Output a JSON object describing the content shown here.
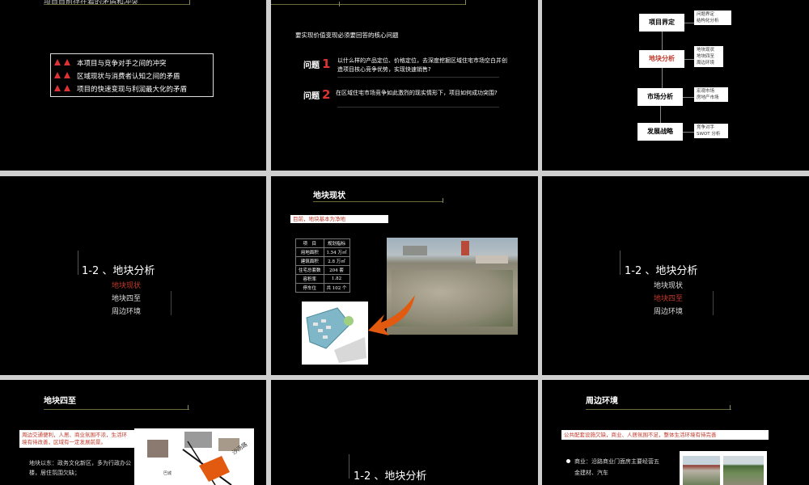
{
  "slide1": {
    "top_text": "项目目前存在着的矛盾和冲突",
    "items": [
      "本项目与竞争对手之间的冲突",
      "区域现状与消费者认知之间的矛盾",
      "项目的快速变现与利润最大化的矛盾"
    ]
  },
  "slide2": {
    "heading": "要实现价值变现必须要回答的核心问题",
    "q_label": "问题",
    "q1_num": "1",
    "q1_text": "以什么样的产品定位、价格定位，去深度挖掘区域住宅市场空白并创造项目核心竞争优势，实现快速销售?",
    "q2_num": "2",
    "q2_text": "在区域住宅市场竞争如此激烈的现实情形下，项目如何成功突围?"
  },
  "slide3": {
    "boxes": [
      "项目界定",
      "地块分析",
      "市场分析",
      "发展战略"
    ],
    "notes": [
      [
        "问题界定",
        "结构化分析"
      ],
      [
        "地块现状",
        "地块四至",
        "周边环境"
      ],
      [
        "宏观市场",
        "房地产市场"
      ],
      [
        "竞争对手",
        "SWOT 分析"
      ]
    ],
    "highlight_color": "#c0392b"
  },
  "slide4": {
    "title": "1-2 、地块分析",
    "items": [
      "地块现状",
      "地块四至",
      "周边环境"
    ],
    "active_index": 0
  },
  "slide5": {
    "title": "地块现状",
    "note": "目前，地块基本为净地",
    "table_header": [
      "项　目",
      "规划指标"
    ],
    "table_rows": [
      [
        "用地面积",
        "1.54 万㎡"
      ],
      [
        "建筑面积",
        "2.8 万㎡"
      ],
      [
        "住宅总套数",
        "204 套"
      ],
      [
        "容积率",
        "1.82"
      ],
      [
        "停车位",
        "共 102 个"
      ]
    ]
  },
  "slide6": {
    "title": "1-2 、地块分析",
    "items": [
      "地块现状",
      "地块四至",
      "周边环境"
    ],
    "active_index": 1
  },
  "slide7": {
    "title": "地块四至",
    "note": "周边交通便利，人居、商业氛围不浓，生活环境有待改善，区域有一定发展前景。",
    "body": "地块以东：政务文化新区，多为行政办公楼，居住氛围欠缺；",
    "map_label": "沙汤路",
    "map_label2": "巴城"
  },
  "slide8": {
    "title": "1-2 、地块分析"
  },
  "slide9": {
    "title": "周边环境",
    "note": "公共配套设施欠缺，商业、人居氛围不足，整体生活环境有待完善",
    "bullet": "商业：沿路商业门面房主要经营五金建材、汽车"
  }
}
